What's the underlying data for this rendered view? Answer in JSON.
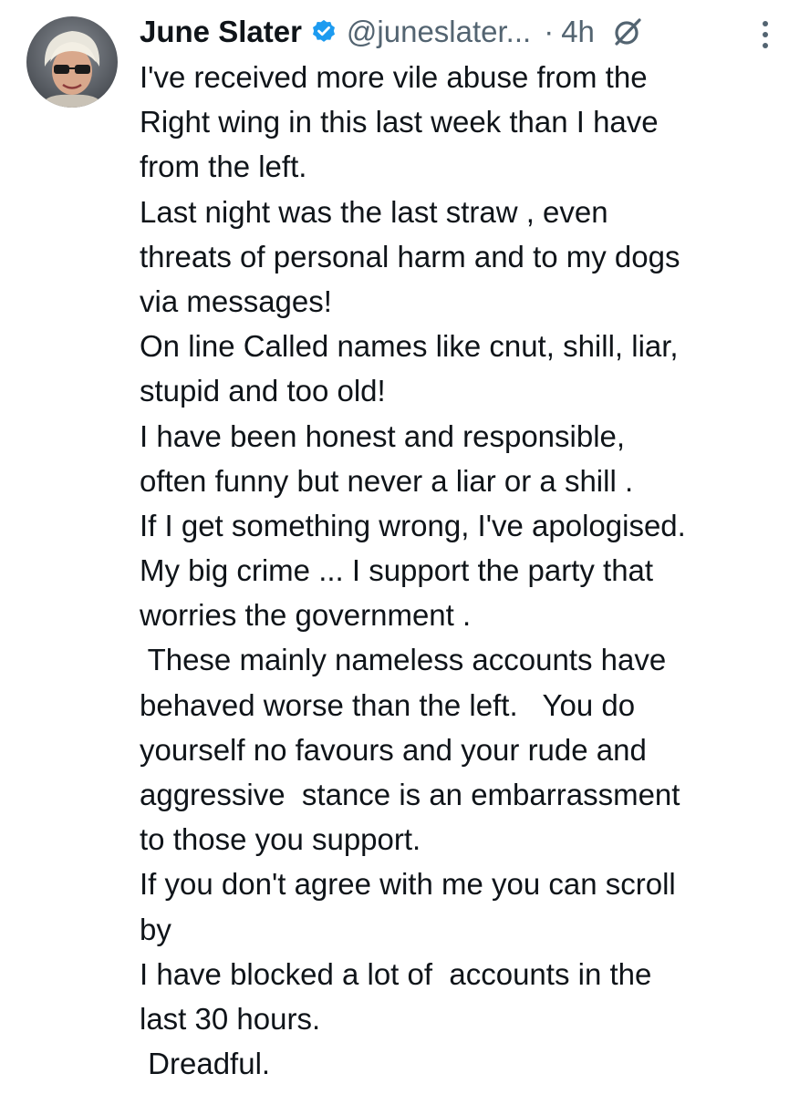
{
  "author": {
    "display_name": "June Slater",
    "handle": "@juneslater...",
    "separator": "·",
    "timestamp": "4h",
    "avatar_icon": "profile-photo-avatar",
    "verified_icon": "verified-badge-icon",
    "verified_color": "#1d9bf0"
  },
  "actions": {
    "grok_icon": "grok-icon",
    "more_icon": "more-options-icon"
  },
  "tweet": {
    "lines": [
      "I've received more vile abuse from the",
      "Right wing in this last week than I have",
      "from the left.",
      "Last night was the last straw , even",
      "threats of personal harm and to my dogs",
      "via messages!",
      "On line Called names like cnut, shill, liar,",
      "stupid and too old!",
      "I have been honest and responsible,",
      "often funny but never a liar or a shill .",
      "If I get something wrong, I've apologised.",
      "My big crime ... I support the party that",
      "worries the government .",
      " These mainly nameless accounts have",
      "behaved worse than the left.   You do",
      "yourself no favours and your rude and",
      "aggressive  stance is an embarrassment",
      "to those you support.",
      "If you don't agree with me you can scroll",
      "by",
      "I have blocked a lot of  accounts in the",
      "last 30 hours.",
      " Dreadful."
    ]
  }
}
